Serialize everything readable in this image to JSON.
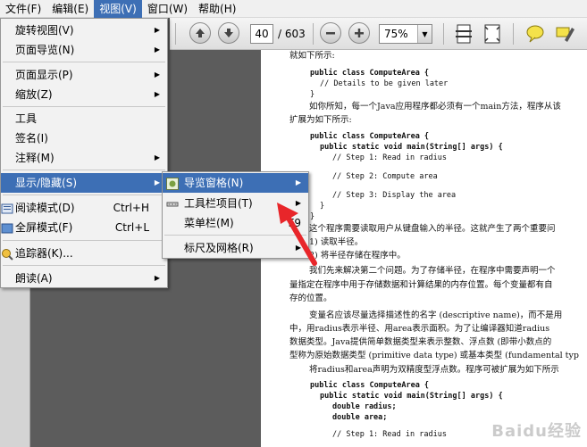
{
  "menubar": {
    "items": [
      "文件(F)",
      "编辑(E)",
      "视图(V)",
      "窗口(W)",
      "帮助(H)"
    ],
    "active_index": 2
  },
  "toolbar": {
    "page_current": "40",
    "page_total": "/ 603",
    "zoom_value": "75%",
    "icons": [
      "prev-page-icon",
      "next-page-icon",
      "zoom-out-icon",
      "zoom-in-icon",
      "fit-page-icon",
      "fit-width-icon",
      "comment-icon",
      "highlight-icon"
    ]
  },
  "view_menu": {
    "items": [
      {
        "label": "旋转视图(V)",
        "submenu": true
      },
      {
        "label": "页面导览(N)",
        "submenu": true
      },
      {
        "label": "页面显示(P)",
        "submenu": true
      },
      {
        "label": "缩放(Z)",
        "submenu": true
      },
      {
        "label": "工具",
        "submenu": false
      },
      {
        "label": "签名(I)",
        "submenu": false
      },
      {
        "label": "注释(M)",
        "submenu": true
      },
      {
        "label": "显示/隐藏(S)",
        "submenu": true,
        "highlighted": true
      },
      {
        "label": "阅读模式(D)",
        "shortcut": "Ctrl+H"
      },
      {
        "label": "全屏模式(F)",
        "shortcut": "Ctrl+L"
      },
      {
        "label": "追踪器(K)..."
      },
      {
        "label": "朗读(A)",
        "submenu": true
      }
    ]
  },
  "show_hide_submenu": {
    "items": [
      {
        "label": "导览窗格(N)",
        "highlighted": true
      },
      {
        "label": "工具栏项目(T)"
      },
      {
        "label": "菜单栏(M)",
        "shortcut": "F9"
      },
      {
        "label": "标尺及网格(R)"
      }
    ]
  },
  "document": {
    "lines": [
      "就如下所示:",
      "public class ComputeArea {",
      "// Details to be given later",
      "}",
      "如你所知，每一个Java应用程序都必须有一个main方法，程序从该",
      "扩展为如下所示:",
      "public class ComputeArea {",
      "public static void main(String[] args) {",
      "// Step 1: Read in radius",
      "// Step 2: Compute area",
      "// Step 3: Display the area",
      "}",
      "}",
      "这个程序需要读取用户从键盘输入的半径。这就产生了两个重要问",
      "1) 读取半径。",
      "2) 将半径存储在程序中。",
      "我们先来解决第二个问题。为了存储半径，在程序中需要声明一个",
      "量指定在程序中用于存储数据和计算结果的内存位置。每个变量都有自",
      "存的位置。",
      "变量名应该尽量选择描述性的名字 (descriptive name)，而不是用",
      "中，用radius表示半径、用area表示面积。为了让编译器知道radius",
      "数据类型。Java提供简单数据类型来表示整数、浮点数 (即带小数点的",
      "型称为原始数据类型 (primitive data type) 或基本类型 (fundamental typ",
      "将radius和area声明为双精度型浮点数。程序可被扩展为如下所示",
      "public class ComputeArea {",
      "public static void main(String[] args) {",
      "double radius;",
      "double area;",
      "// Step 1: Read in radius"
    ],
    "watermark": "Baidu经验"
  }
}
